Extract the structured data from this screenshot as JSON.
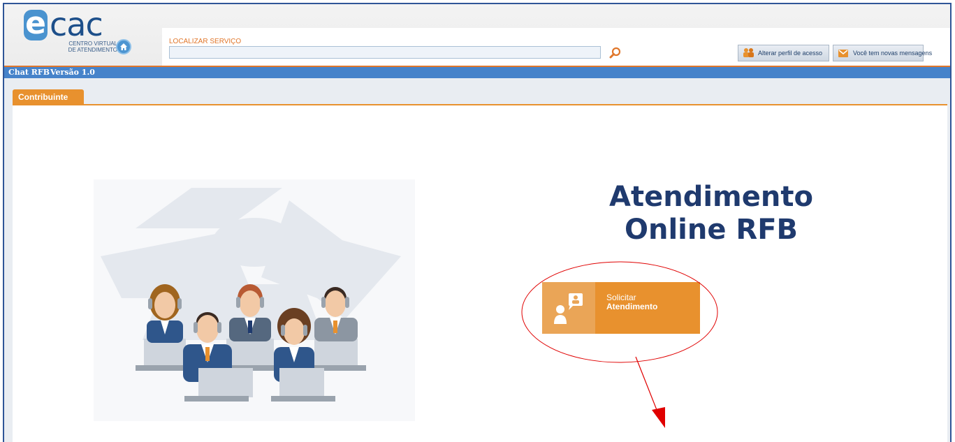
{
  "logo": {
    "letter": "e",
    "wordmark": "cac",
    "subtitle_line1": "Centro Virtual",
    "subtitle_line2": "de Atendimento"
  },
  "search": {
    "label": "LOCALIZAR SERVIÇO",
    "value": "",
    "placeholder": ""
  },
  "header_buttons": {
    "profile": "Alterar perfil de acesso",
    "messages": "Você tem novas mensagens"
  },
  "app_bar": {
    "name": "Chat RFB",
    "version": "Versão 1.0"
  },
  "tabs": [
    {
      "label": "Contribuinte",
      "active": true
    }
  ],
  "main": {
    "headline_line1": "Atendimento",
    "headline_line2": "Online RFB",
    "action_line1": "Solicitar",
    "action_line2": "Atendimento"
  },
  "colors": {
    "accent_orange": "#e8912e",
    "bar_blue": "#4683ca",
    "headline_navy": "#1f3a6e",
    "annotation_red": "#e00000"
  },
  "icons": {
    "home": "home-icon",
    "search": "search-icon",
    "profile": "users-icon",
    "messages": "mail-icon",
    "action": "chat-person-icon"
  }
}
